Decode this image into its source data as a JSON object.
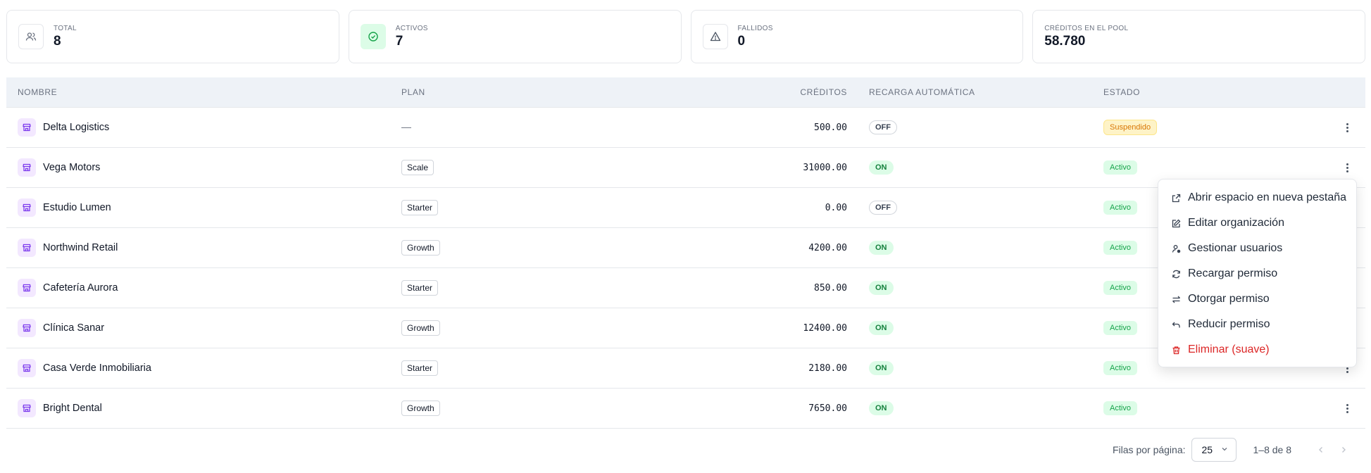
{
  "stats": [
    {
      "label": "TOTAL",
      "value": "8",
      "icon": "users-icon"
    },
    {
      "label": "ACTIVOS",
      "value": "7",
      "icon": "check-circle-icon"
    },
    {
      "label": "FALLIDOS",
      "value": "0",
      "icon": "warning-triangle-icon"
    },
    {
      "label": "CRÉDITOS EN EL POOL",
      "value": "58.780"
    }
  ],
  "table": {
    "headers": {
      "name": "NOMBRE",
      "plan": "PLAN",
      "credits": "CRÉDITOS",
      "auto": "RECARGA AUTOMÁTICA",
      "status": "ESTADO"
    },
    "rows": [
      {
        "name": "Delta Logistics",
        "plan": "—",
        "credits": "500.00",
        "auto": "OFF",
        "status": "Suspendido"
      },
      {
        "name": "Vega Motors",
        "plan": "Scale",
        "credits": "31000.00",
        "auto": "ON",
        "status": "Activo"
      },
      {
        "name": "Estudio Lumen",
        "plan": "Starter",
        "credits": "0.00",
        "auto": "OFF",
        "status": "Activo"
      },
      {
        "name": "Northwind Retail",
        "plan": "Growth",
        "credits": "4200.00",
        "auto": "ON",
        "status": "Activo"
      },
      {
        "name": "Cafetería Aurora",
        "plan": "Starter",
        "credits": "850.00",
        "auto": "ON",
        "status": "Activo"
      },
      {
        "name": "Clínica Sanar",
        "plan": "Growth",
        "credits": "12400.00",
        "auto": "ON",
        "status": "Activo"
      },
      {
        "name": "Casa Verde Inmobiliaria",
        "plan": "Starter",
        "credits": "2180.00",
        "auto": "ON",
        "status": "Activo"
      },
      {
        "name": "Bright Dental",
        "plan": "Growth",
        "credits": "7650.00",
        "auto": "ON",
        "status": "Activo"
      }
    ]
  },
  "menu": {
    "items": [
      {
        "label": "Abrir espacio en nueva pestaña",
        "icon": "external-link-icon"
      },
      {
        "label": "Editar organización",
        "icon": "edit-icon"
      },
      {
        "label": "Gestionar usuarios",
        "icon": "user-settings-icon"
      },
      {
        "label": "Recargar permiso",
        "icon": "refresh-icon"
      },
      {
        "label": "Otorgar permiso",
        "icon": "transfer-icon"
      },
      {
        "label": "Reducir permiso",
        "icon": "undo-icon"
      },
      {
        "label": "Eliminar (suave)",
        "icon": "trash-icon",
        "danger": true
      }
    ]
  },
  "pagination": {
    "rows_label": "Filas por página:",
    "rows_value": "25",
    "range": "1–8 de 8"
  },
  "colors": {
    "accent_purple": "#7c3aed",
    "active_green": "#16a34a",
    "suspended_orange": "#d97706",
    "danger_red": "#dc2626"
  }
}
